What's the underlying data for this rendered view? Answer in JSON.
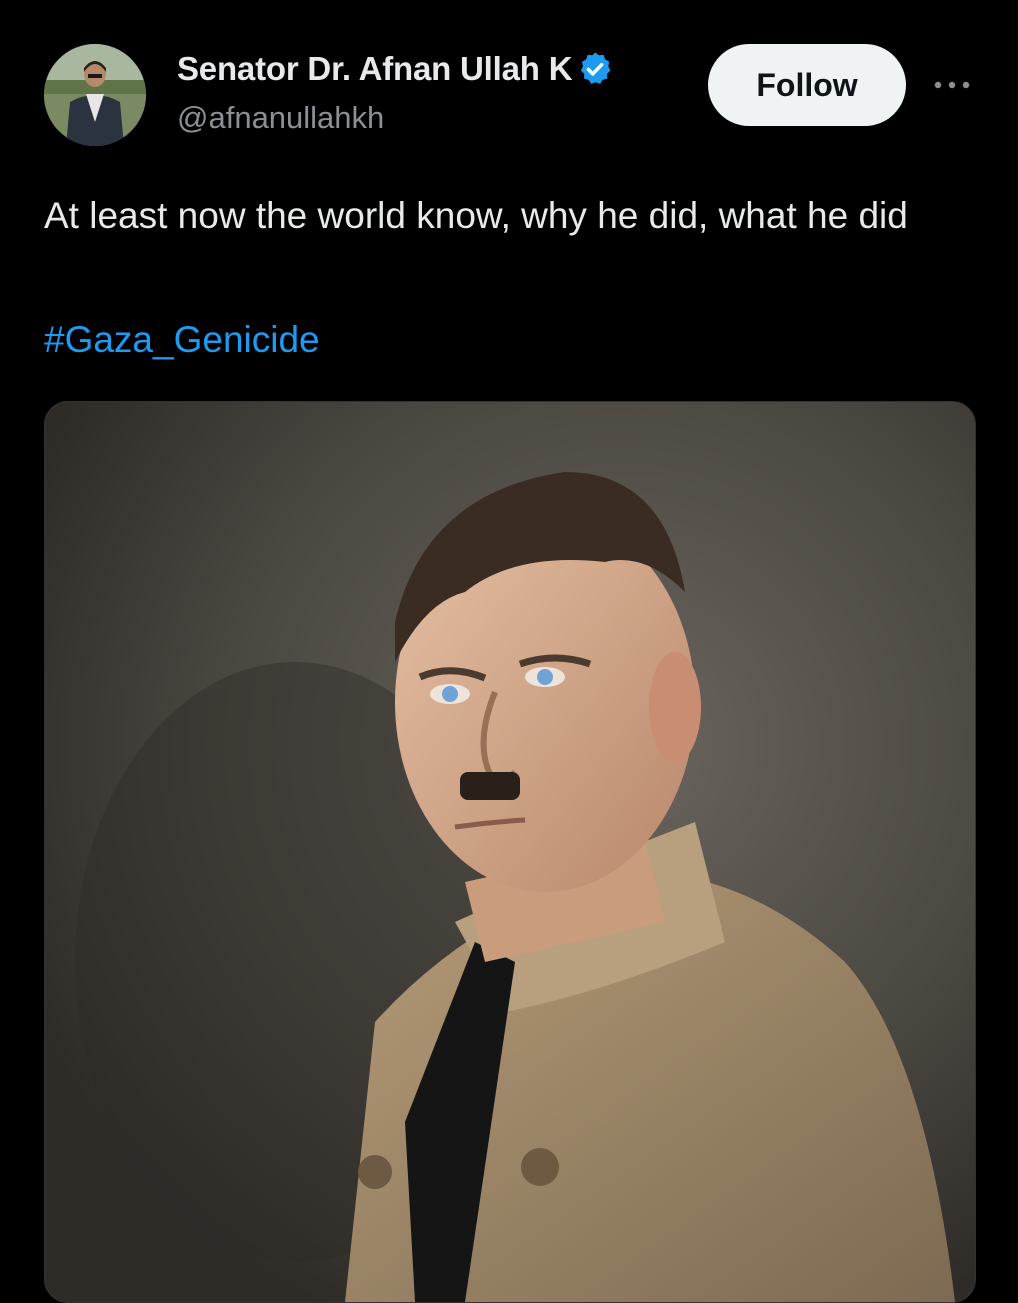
{
  "tweet": {
    "author": {
      "display_name": "Senator Dr. Afnan Ullah K",
      "handle": "@afnanullahkh",
      "avatar_icon": "profile-photo",
      "verified_icon": "verified-badge-icon",
      "verified_color": "#1d9bf0"
    },
    "follow_label": "Follow",
    "more_icon": "more-options-icon",
    "text": "At least now the world know, why he did, what he did",
    "hashtag": "#Gaza_Genicide",
    "hashtag_color": "#1d9bf0",
    "media": {
      "kind": "colorized historical portrait photograph"
    }
  },
  "colors": {
    "background": "#000000",
    "text_primary": "#e7e9ea",
    "text_secondary": "#8b9096",
    "follow_bg": "#eff3f4",
    "follow_text": "#0f1419"
  }
}
